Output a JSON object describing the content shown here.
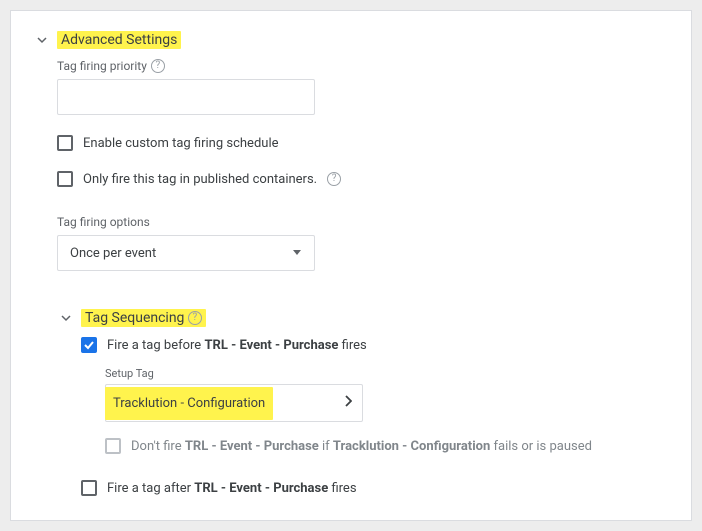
{
  "advanced": {
    "title": "Advanced Settings",
    "priority_label": "Tag firing priority",
    "enable_schedule": "Enable custom tag firing schedule",
    "published_only": "Only fire this tag in published containers.",
    "options_label": "Tag firing options",
    "options_value": "Once per event"
  },
  "seq": {
    "title": "Tag Sequencing",
    "before_prefix": "Fire a tag before ",
    "before_tag": "TRL - Event - Purchase",
    "before_suffix": " fires",
    "setup_label": "Setup Tag",
    "setup_value": "Tracklution - Configuration",
    "dont_prefix": "Don't fire ",
    "dont_mid": " if ",
    "dont_suffix": " fails or is paused",
    "after_prefix": "Fire a tag after ",
    "after_tag": "TRL - Event - Purchase",
    "after_suffix": " fires"
  }
}
